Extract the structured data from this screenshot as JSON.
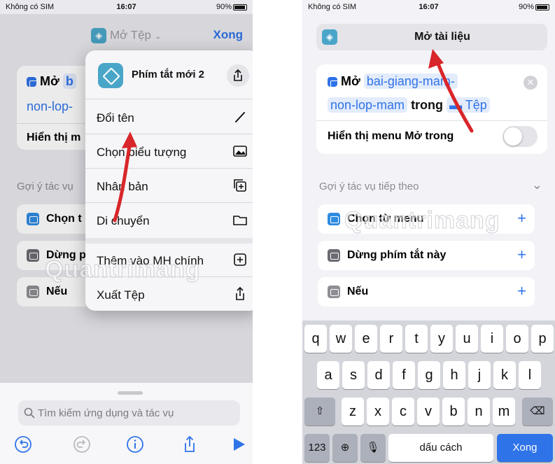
{
  "status": {
    "carrier": "Không có SIM",
    "time": "16:07",
    "battery": "90%"
  },
  "left": {
    "nav": {
      "title": "Mở Tệp",
      "done": "Xong"
    },
    "action": {
      "verb": "Mở",
      "partial_value": "b",
      "partial_value_line2": "non-lop-",
      "show_menu_partial": "Hiển thị m"
    },
    "suggest_label": "Gợi ý tác vụ",
    "rows": [
      {
        "label": "Chọn t"
      },
      {
        "label": "Dừng p"
      },
      {
        "label": "Nếu"
      }
    ],
    "popup": {
      "title": "Phím tắt mới 2",
      "items": [
        "Đổi tên",
        "Chọn biểu tượng",
        "Nhân bản",
        "Di chuyển",
        "Thêm vào MH chính",
        "Xuất Tệp"
      ]
    },
    "search_placeholder": "Tìm kiếm ứng dụng và tác vụ",
    "watermark": "Quantrimang"
  },
  "right": {
    "name_field_value": "Mở tài liệu",
    "action": {
      "verb": "Mở",
      "value_line1": "bai-giang-mam-",
      "value_line2": "non-lop-mam",
      "connector": "trong",
      "location": "Tệp"
    },
    "show_menu": "Hiển thị menu Mở trong",
    "suggest_label": "Gợi ý tác vụ tiếp theo",
    "rows": [
      {
        "label": "Chọn từ menu",
        "color": "#2f8be0"
      },
      {
        "label": "Dừng phím tắt này",
        "color": "#6b6b72"
      },
      {
        "label": "Nếu",
        "color": "#8e8e93"
      }
    ],
    "keyboard": {
      "row1": [
        "q",
        "w",
        "e",
        "r",
        "t",
        "y",
        "u",
        "i",
        "o",
        "p"
      ],
      "row2": [
        "a",
        "s",
        "d",
        "f",
        "g",
        "h",
        "j",
        "k",
        "l"
      ],
      "row3": [
        "z",
        "x",
        "c",
        "v",
        "b",
        "n",
        "m"
      ],
      "number_key": "123",
      "space": "dấu cách",
      "go": "Xong"
    },
    "watermark": "Quantrimang"
  },
  "colors": {
    "accent": "#2f73e8",
    "arrow": "#d8262a",
    "shortcut_icon": "#4aa6c9"
  }
}
